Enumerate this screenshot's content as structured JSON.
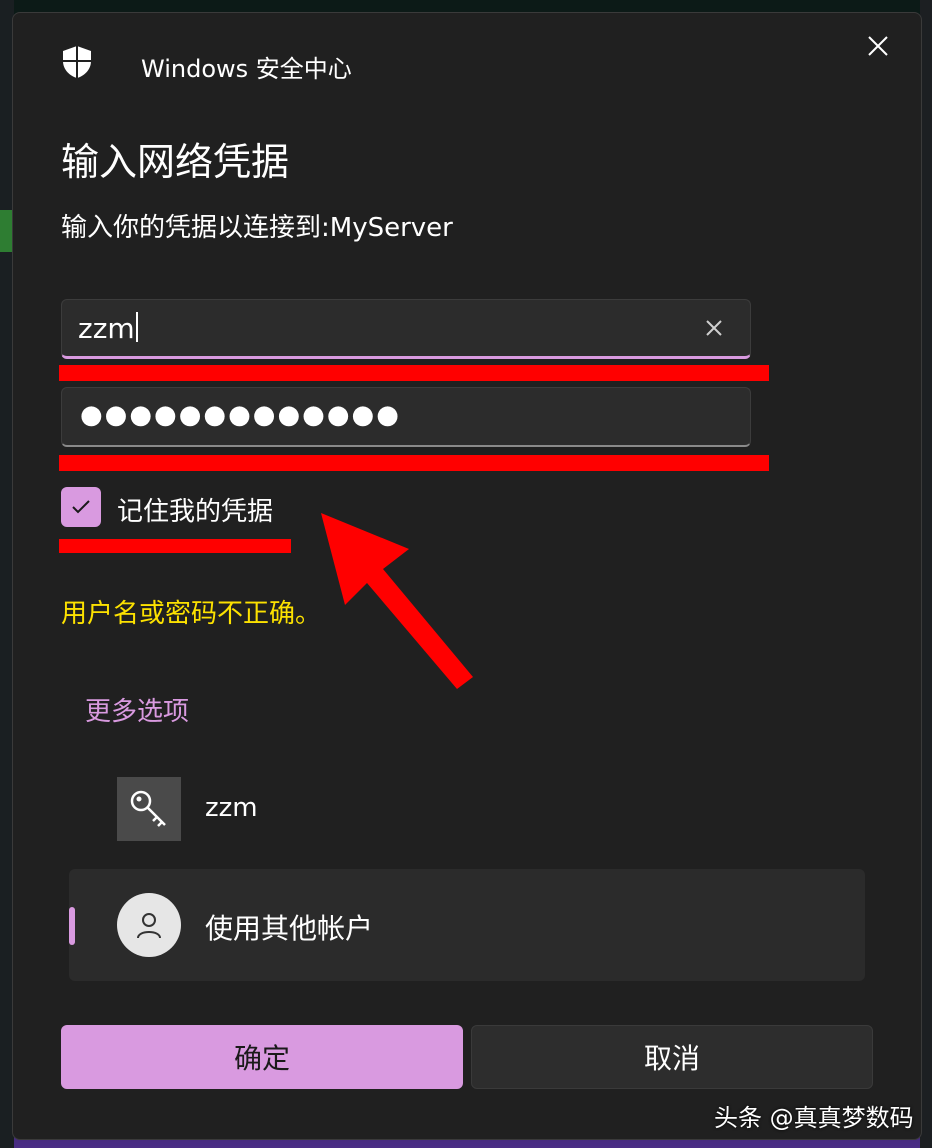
{
  "window": {
    "app_title": "Windows 安全中心",
    "close_icon": "close-icon"
  },
  "dialog": {
    "heading": "输入网络凭据",
    "subheading": "输入你的凭据以连接到:MyServer",
    "username_value": "zzm",
    "password_mask": "●●●●●●●●●●●●●",
    "remember_label": "记住我的凭据",
    "remember_checked": true,
    "error_message": "用户名或密码不正确。",
    "more_options_label": "更多选项",
    "accounts": [
      {
        "icon": "key-icon",
        "label": "zzm"
      },
      {
        "icon": "person-icon",
        "label": "使用其他帐户",
        "selected": true
      }
    ],
    "ok_label": "确定",
    "cancel_label": "取消"
  },
  "colors": {
    "accent": "#d99ae0",
    "error": "#fce100",
    "annotation": "#ff0000",
    "dialog_bg": "#202020"
  },
  "watermark": "头条 @真真梦数码"
}
